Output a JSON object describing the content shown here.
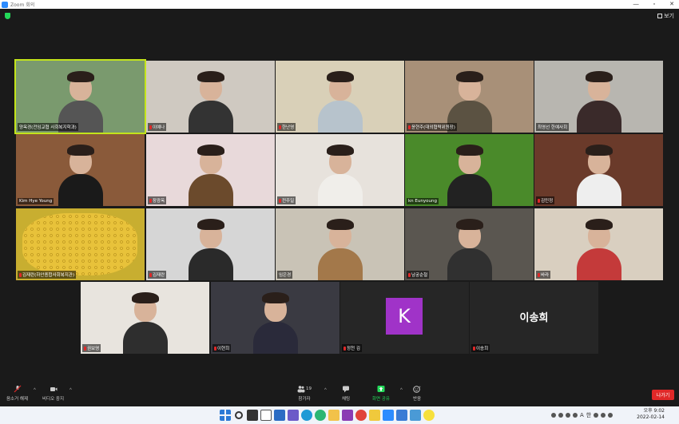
{
  "window": {
    "title": "Zoom 회의",
    "controls": [
      "—",
      "▫",
      "✕"
    ]
  },
  "topbar": {
    "view_label": "보기"
  },
  "participants": [
    {
      "name": "양옥경(전임교협 사회복지학과)",
      "muted": false,
      "bg": "#7a9a6e",
      "shirt": "#555",
      "active": true
    },
    {
      "name": "이예나",
      "muted": true,
      "bg": "#cfc9c1",
      "shirt": "#333"
    },
    {
      "name": "한난영",
      "muted": true,
      "bg": "#d9d0b8",
      "shirt": "#b7c3cc"
    },
    {
      "name": "윤현주(대외협력위원장)",
      "muted": true,
      "bg": "#a89078",
      "shirt": "#5b5242"
    },
    {
      "name": "최영선 한예사회",
      "muted": false,
      "bg": "#b8b6b0",
      "shirt": "#3a2a2a"
    },
    {
      "name": "Kim Hye Young",
      "muted": false,
      "bg": "#8a5a3a",
      "shirt": "#1a1a1a"
    },
    {
      "name": "장광옥",
      "muted": true,
      "bg": "#e8d9da",
      "shirt": "#6b4a2c"
    },
    {
      "name": "전주일",
      "muted": true,
      "bg": "#e7e2dc",
      "shirt": "#f0eeea"
    },
    {
      "name": "kn Eunyoung",
      "muted": false,
      "bg": "#4a8a2a",
      "shirt": "#222"
    },
    {
      "name": "김민정",
      "muted": true,
      "bg": "#6a3a2a",
      "shirt": "#eeeeee"
    },
    {
      "name": "김재란(하안종합사회복지관)",
      "muted": true,
      "bg": "#c8ae30",
      "shirt": "#c8ae30",
      "no_person": true
    },
    {
      "name": "김재란",
      "muted": true,
      "bg": "#d6d6d6",
      "shirt": "#2a2a2a"
    },
    {
      "name": "임은경",
      "muted": false,
      "bg": "#c9c3b6",
      "shirt": "#a3784a"
    },
    {
      "name": "남궁순철",
      "muted": true,
      "bg": "#5a5650",
      "shirt": "#303030"
    },
    {
      "name": "바라",
      "muted": true,
      "bg": "#d9cfc0",
      "shirt": "#c43a3a"
    },
    {
      "name": "권보영",
      "muted": true,
      "bg": "#e8e4de",
      "shirt": "#2e2e2e"
    },
    {
      "name": "이현희",
      "muted": true,
      "bg": "#3a3a42",
      "shirt": "#2a2a3a"
    },
    {
      "name": "정천 김",
      "muted": true,
      "avatar_letter": "K",
      "bg": "#262626"
    },
    {
      "name": "이송희",
      "muted": true,
      "big_name": "이송희",
      "bg": "#262626"
    }
  ],
  "toolbar": {
    "audio": "음소거 해제",
    "video": "비디오 중지",
    "participants": "참가자",
    "participants_count": "19",
    "chat": "채팅",
    "share": "화면 공유",
    "reactions": "반응",
    "leave": "나가기"
  },
  "taskbar": {
    "ime": "A",
    "lang": "한",
    "time_label": "오후 9:02",
    "date": "2022-02-14"
  },
  "colors": {
    "accent_green": "#23d959",
    "leave_red": "#e02828",
    "active_border": "#c3e41b",
    "avatar_purple": "#a033c8"
  }
}
